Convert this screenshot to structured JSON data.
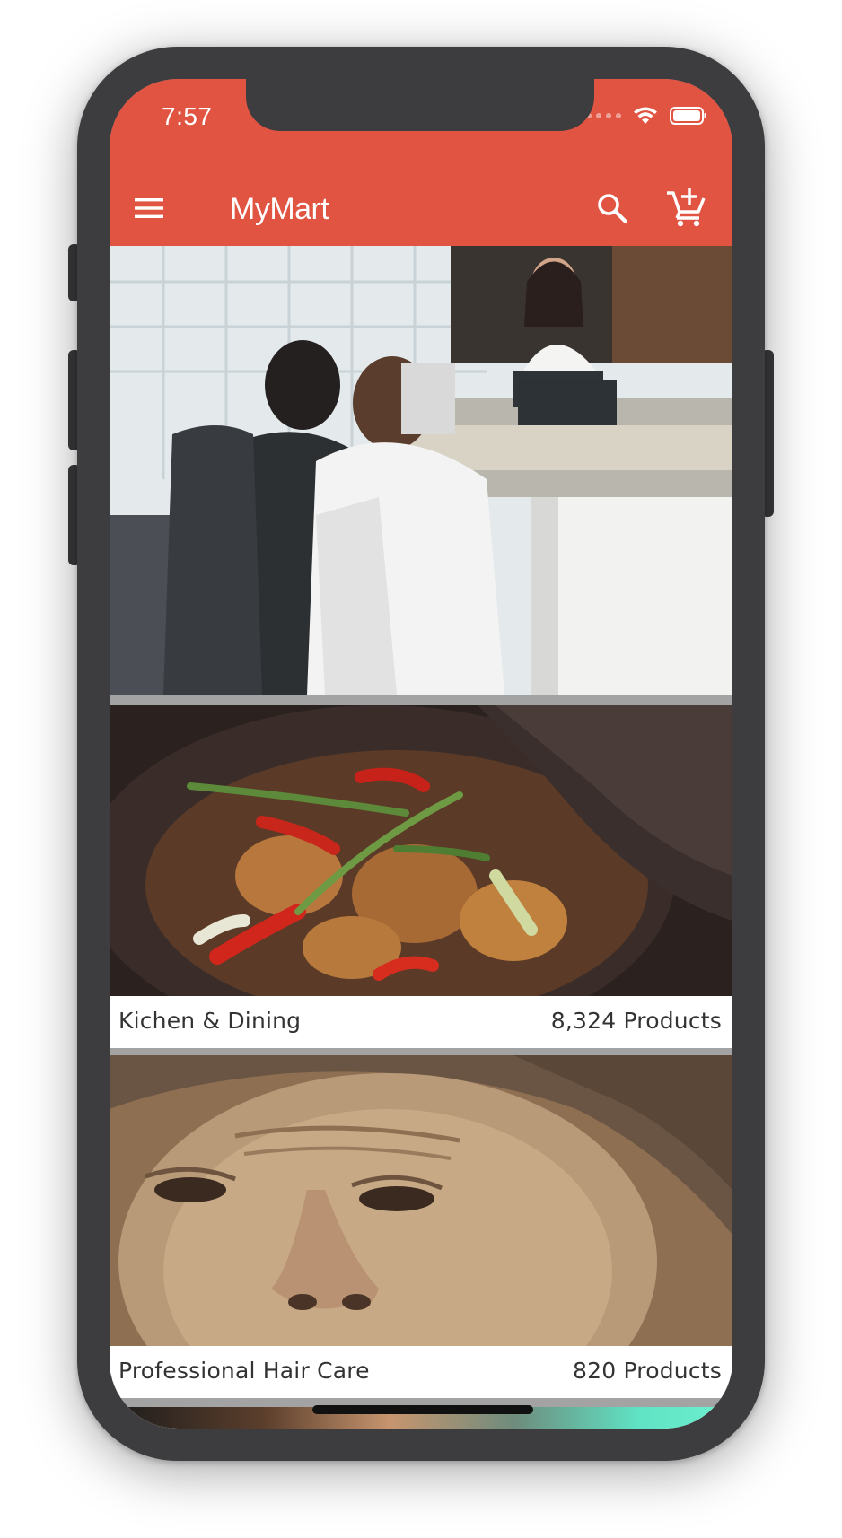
{
  "status_bar": {
    "time": "7:57"
  },
  "app_bar": {
    "title": "MyMart",
    "icons": [
      "menu-icon",
      "search-icon",
      "add-shopping-cart-icon"
    ]
  },
  "categories": [
    {
      "image": "office-workers-photo",
      "label": "",
      "count": ""
    },
    {
      "image": "braised-dish-clay-pot-photo",
      "label": "Kichen & Dining",
      "count": "8,324 Products"
    },
    {
      "image": "elderly-woman-portrait-photo",
      "label": "Professional Hair Care",
      "count": "820 Products"
    }
  ],
  "colors": {
    "app_bar": "#e15442",
    "device_frame": "#3d3d3f",
    "divider": "#a3a3a3"
  }
}
